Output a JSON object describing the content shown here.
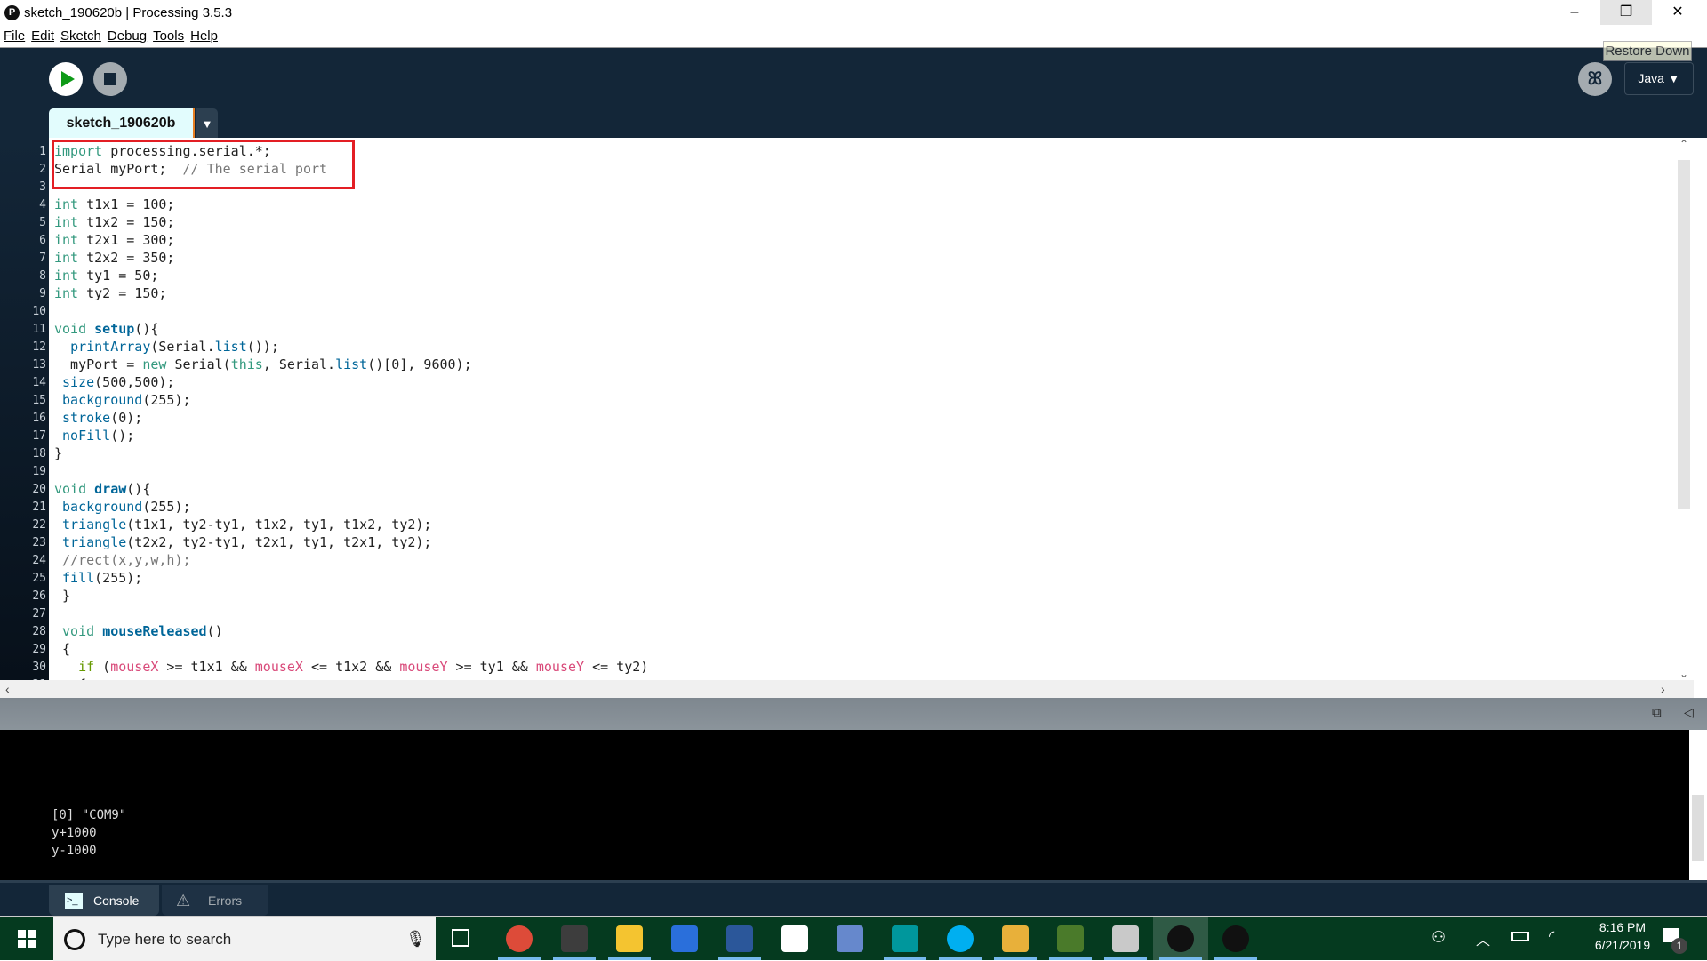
{
  "window": {
    "title": "sketch_190620b | Processing 3.5.3",
    "app_icon": "processing-logo",
    "minimize": "–",
    "restore": "❐",
    "close": "✕",
    "tooltip": "Restore Down"
  },
  "menu": [
    "File",
    "Edit",
    "Sketch",
    "Debug",
    "Tools",
    "Help"
  ],
  "toolbar": {
    "run_icon": "play-icon",
    "stop_icon": "stop-icon",
    "mode_icon": "debugger-butterfly-icon",
    "mode_glyph": "ꕤ",
    "mode": "Java ▼"
  },
  "tab": {
    "label": "sketch_190620b",
    "dropdown": "▼"
  },
  "editor": {
    "lines": [
      [
        [
          "import",
          "kw"
        ],
        [
          " processing.serial.*;",
          ""
        ]
      ],
      [
        [
          "Serial myPort;  ",
          ""
        ],
        [
          "// The serial port",
          "cm"
        ]
      ],
      [],
      [
        [
          "int",
          "kw"
        ],
        [
          " t1x1 = 100;",
          ""
        ]
      ],
      [
        [
          "int",
          "kw"
        ],
        [
          " t1x2 = 150;",
          ""
        ]
      ],
      [
        [
          "int",
          "kw"
        ],
        [
          " t2x1 = 300;",
          ""
        ]
      ],
      [
        [
          "int",
          "kw"
        ],
        [
          " t2x2 = 350;",
          ""
        ]
      ],
      [
        [
          "int",
          "kw"
        ],
        [
          " ty1 = 50;",
          ""
        ]
      ],
      [
        [
          "int",
          "kw"
        ],
        [
          " ty2 = 150;",
          ""
        ]
      ],
      [],
      [
        [
          "void",
          "kw"
        ],
        [
          " ",
          ""
        ],
        [
          "setup",
          "fb"
        ],
        [
          "(){",
          ""
        ]
      ],
      [
        [
          "  ",
          ""
        ],
        [
          "printArray",
          "fn"
        ],
        [
          "(Serial.",
          ""
        ],
        [
          "list",
          "fn"
        ],
        [
          "());",
          ""
        ]
      ],
      [
        [
          "  myPort = ",
          ""
        ],
        [
          "new",
          "kw"
        ],
        [
          " Serial(",
          ""
        ],
        [
          "this",
          "kw"
        ],
        [
          ", Serial.",
          ""
        ],
        [
          "list",
          "fn"
        ],
        [
          "()[0], 9600);",
          ""
        ]
      ],
      [
        [
          " ",
          ""
        ],
        [
          "size",
          "fn"
        ],
        [
          "(500,500);",
          ""
        ]
      ],
      [
        [
          " ",
          ""
        ],
        [
          "background",
          "fn"
        ],
        [
          "(255);",
          ""
        ]
      ],
      [
        [
          " ",
          ""
        ],
        [
          "stroke",
          "fn"
        ],
        [
          "(0);",
          ""
        ]
      ],
      [
        [
          " ",
          ""
        ],
        [
          "noFill",
          "fn"
        ],
        [
          "();",
          ""
        ]
      ],
      [
        [
          "}",
          ""
        ]
      ],
      [],
      [
        [
          "void",
          "kw"
        ],
        [
          " ",
          ""
        ],
        [
          "draw",
          "fb"
        ],
        [
          "(){",
          ""
        ]
      ],
      [
        [
          " ",
          ""
        ],
        [
          "background",
          "fn"
        ],
        [
          "(255);",
          ""
        ]
      ],
      [
        [
          " ",
          ""
        ],
        [
          "triangle",
          "fn"
        ],
        [
          "(t1x1, ty2-ty1, t1x2, ty1, t1x2, ty2);",
          ""
        ]
      ],
      [
        [
          " ",
          ""
        ],
        [
          "triangle",
          "fn"
        ],
        [
          "(t2x2, ty2-ty1, t2x1, ty1, t2x1, ty2);",
          ""
        ]
      ],
      [
        [
          " ",
          ""
        ],
        [
          "//rect(x,y,w,h);",
          "cm"
        ]
      ],
      [
        [
          " ",
          ""
        ],
        [
          "fill",
          "fn"
        ],
        [
          "(255);",
          ""
        ]
      ],
      [
        [
          " }",
          ""
        ]
      ],
      [],
      [
        [
          " ",
          ""
        ],
        [
          "void",
          "kw"
        ],
        [
          " ",
          ""
        ],
        [
          "mouseReleased",
          "fb"
        ],
        [
          "()",
          ""
        ]
      ],
      [
        [
          " {",
          ""
        ]
      ],
      [
        [
          "   ",
          ""
        ],
        [
          "if",
          "ct"
        ],
        [
          " (",
          ""
        ],
        [
          "mouseX",
          "pv"
        ],
        [
          " >= t1x1 && ",
          ""
        ],
        [
          "mouseX",
          "pv"
        ],
        [
          " <= t1x2 && ",
          ""
        ],
        [
          "mouseY",
          "pv"
        ],
        [
          " >= ty1 && ",
          ""
        ],
        [
          "mouseY",
          "pv"
        ],
        [
          " <= ty2)",
          ""
        ]
      ],
      [
        [
          "   {",
          ""
        ]
      ]
    ]
  },
  "console": {
    "lines": [
      "[0] \"COM9\"",
      "y+1000",
      "y-1000"
    ],
    "tabs": [
      {
        "label": "Console",
        "icon": "terminal-icon"
      },
      {
        "label": "Errors",
        "icon": "warning-icon"
      }
    ]
  },
  "taskbar": {
    "search_placeholder": "Type here to search",
    "time": "8:16 PM",
    "date": "6/21/2019",
    "notifications": "1",
    "apps": [
      {
        "name": "chrome",
        "color": "#dd4b39"
      },
      {
        "name": "sublime-text",
        "color": "#3d3d3d"
      },
      {
        "name": "file-explorer",
        "color": "#f4c430"
      },
      {
        "name": "scanner",
        "color": "#2a6fdb"
      },
      {
        "name": "word",
        "color": "#2b579a"
      },
      {
        "name": "store",
        "color": "#ffffff"
      },
      {
        "name": "network",
        "color": "#6688cc"
      },
      {
        "name": "arduino",
        "color": "#00979c"
      },
      {
        "name": "skype",
        "color": "#00aff0"
      },
      {
        "name": "git-tool",
        "color": "#e8b03a"
      },
      {
        "name": "circuit-tool",
        "color": "#4a7a2a"
      },
      {
        "name": "paint",
        "color": "#c9c9c9"
      },
      {
        "name": "processing",
        "color": "#111111"
      },
      {
        "name": "media-player",
        "color": "#111111"
      }
    ]
  }
}
